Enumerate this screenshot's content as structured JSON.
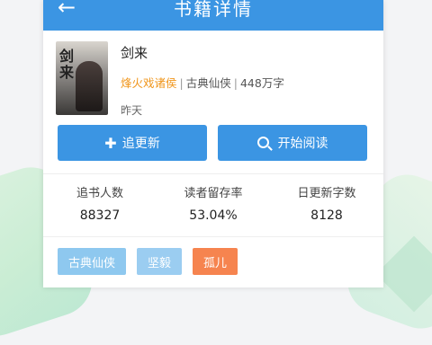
{
  "header": {
    "title": "书籍详情",
    "back_icon": "arrow-left-icon"
  },
  "book": {
    "name": "剑来",
    "cover_text": "剑来",
    "author": "烽火戏诸侯",
    "genre": "古典仙侠",
    "word_count": "448万字",
    "separator": "|",
    "updated": "昨天"
  },
  "actions": {
    "follow_label": "追更新",
    "follow_icon": "plus-icon",
    "read_label": "开始阅读",
    "read_icon": "search-icon"
  },
  "stats": [
    {
      "label": "追书人数",
      "value": "88327"
    },
    {
      "label": "读者留存率",
      "value": "53.04%"
    },
    {
      "label": "日更新字数",
      "value": "8128"
    }
  ],
  "tags": [
    "古典仙侠",
    "坚毅",
    "孤儿"
  ],
  "colors": {
    "primary": "#3b95e3",
    "author": "#f0961c",
    "tag_orange": "#f6844f",
    "tag_blue": "#8ec8ef"
  }
}
